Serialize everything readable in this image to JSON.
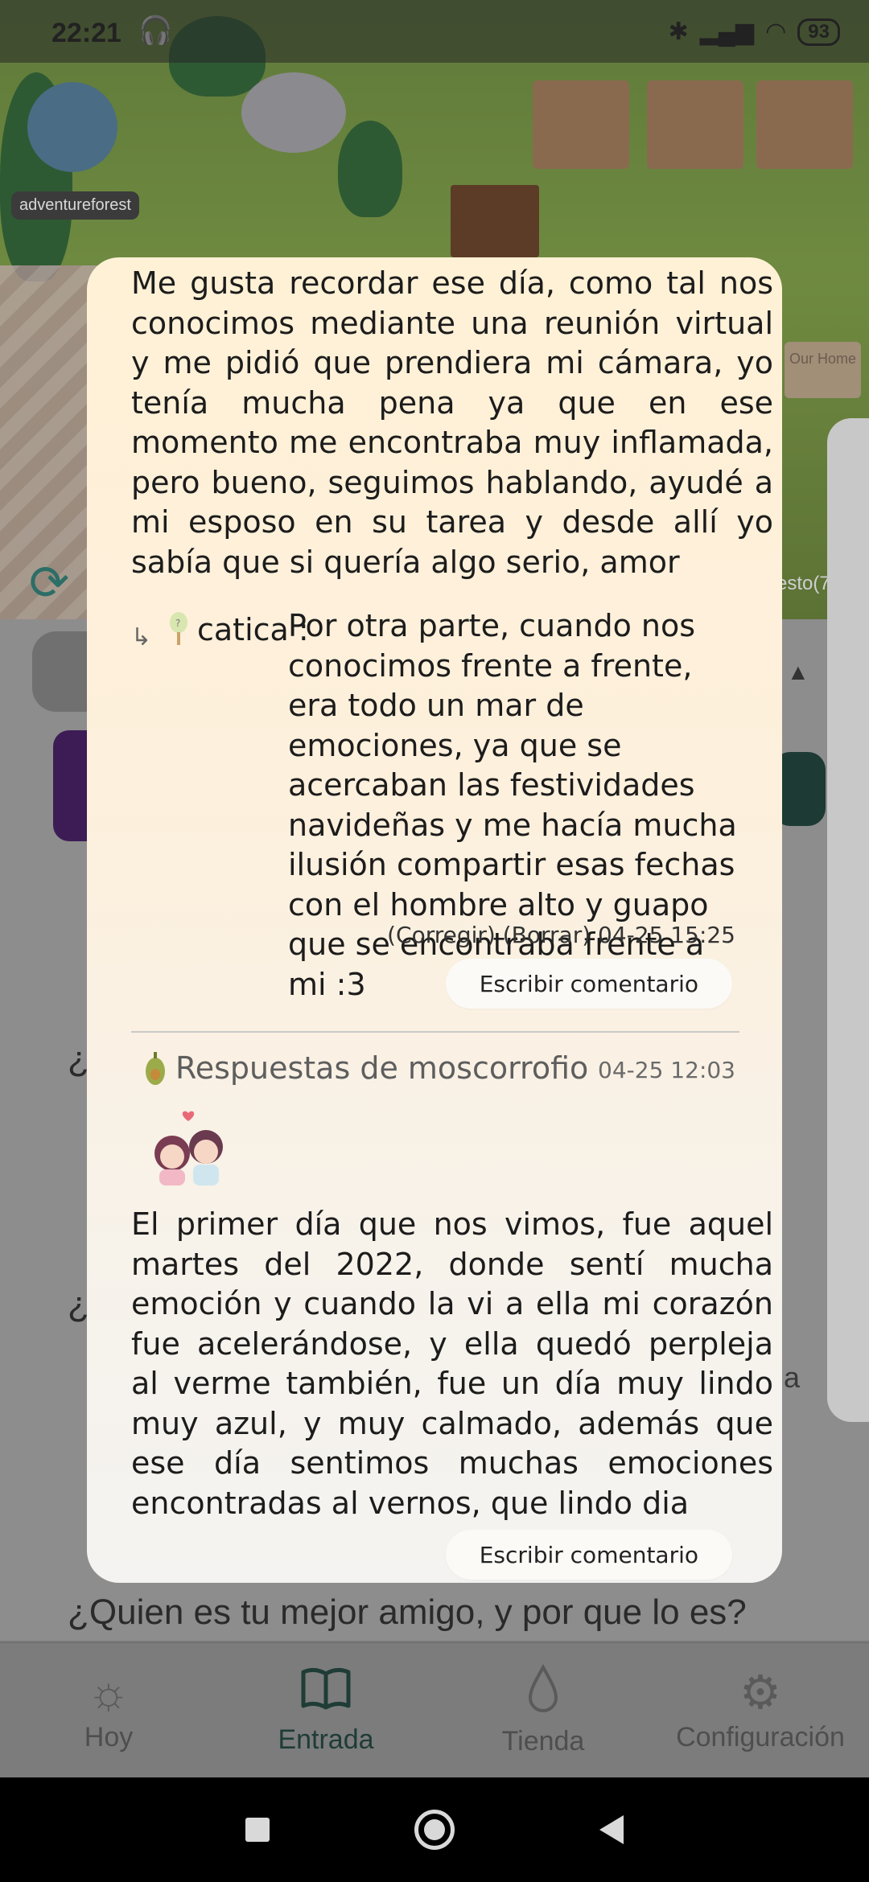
{
  "status_bar": {
    "time": "22:21",
    "battery": "93"
  },
  "scene": {
    "badge_label": "adventureforest",
    "sign_text": "Our Home",
    "edge_text": "esto(7"
  },
  "background": {
    "question_full": "¿Quien es tu mejor amigo, y por que lo es?",
    "question_partial_1": "¿C",
    "question_partial_2": "¿C",
    "tail_fragment": "ja"
  },
  "modal": {
    "entry_text": "Me gusta recordar ese día, como tal nos conocimos mediante una reunión virtual y me pidió que prendiera mi cámara, yo tenía mucha pena ya que en ese momento me encontraba muy inflamada, pero bueno, seguimos hablando, ayudé a mi esposo en su tarea y desde allí  yo sabía que si quería algo serio, amor",
    "reply": {
      "author": "catica :",
      "text": "Por otra parte, cuando nos conocimos frente a frente, era todo un mar de emociones, ya que se acercaban las festividades navideñas y me hacía mucha ilusión compartir esas fechas con el hombre alto y guapo que se encontraba frente a mi :3",
      "edit_label": "(Corregir)",
      "delete_label": "(Borrar)",
      "timestamp": "04-25 15:25"
    },
    "write_comment_label": "Escribir comentario",
    "responses": {
      "title": "Respuestas de moscorrofio",
      "date": "04-25 12:03",
      "text": "El primer día que nos vimos, fue aquel martes del 2022, donde sentí mucha emoción y cuando la vi a ella mi corazón fue acelerándose, y ella quedó perpleja al verme también, fue un día muy lindo muy azul, y muy calmado, además que ese día sentimos muchas emociones encontradas al vernos, que lindo dia"
    },
    "write_comment_label_2": "Escribir comentario"
  },
  "bottom_nav": {
    "items": [
      {
        "label": "Hoy",
        "icon": "sun-icon"
      },
      {
        "label": "Entrada",
        "icon": "book-icon"
      },
      {
        "label": "Tienda",
        "icon": "drop-icon"
      },
      {
        "label": "Configuración",
        "icon": "gear-icon"
      }
    ],
    "active_index": 1
  }
}
